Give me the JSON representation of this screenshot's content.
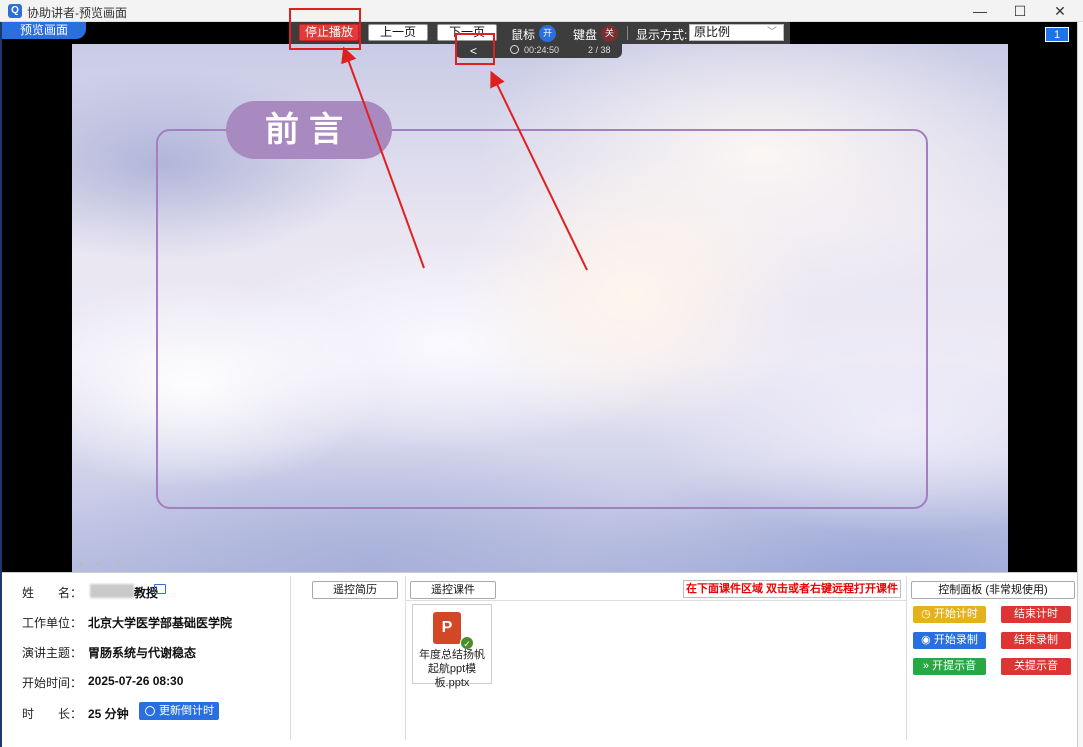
{
  "window": {
    "app_icon": "Q",
    "title": "协助讲者-预览画面",
    "minimize": "—",
    "maximize": "☐",
    "close": "✕"
  },
  "preview": {
    "tab_label": "预览画面",
    "page_badge": "1"
  },
  "slide": {
    "title": "前言"
  },
  "toolbar": {
    "stop_label": "停止播放",
    "prev_label": "上一页",
    "next_label": "下一页",
    "mouse_label": "鼠标",
    "mouse_state": "开",
    "keyboard_label": "键盘",
    "keyboard_state": "关",
    "display_label": "显示方式:",
    "display_value": "原比例",
    "prev_arrow": "<",
    "elapsed": "00:24:50",
    "page_count": "2 / 38"
  },
  "speaker": {
    "name_label": "姓　　名：",
    "name_suffix": "教授",
    "org_label": "工作单位：",
    "org_value": "北京大学医学部基础医学院",
    "topic_label": "演讲主题：",
    "topic_value": "胃肠系统与代谢稳态",
    "start_label": "开始时间：",
    "start_value": "2025-07-26 08:30",
    "duration_label": "时　　长：",
    "duration_value": "25 分钟",
    "countdown_button": "更新倒计时"
  },
  "remote": {
    "cv_button": "遥控简历",
    "courseware_button": "遥控课件",
    "notice": "在下面课件区域 双击或者右键远程打开课件",
    "file_name": "年度总结扬帆起航ppt模板.pptx",
    "file_icon": "P"
  },
  "control_panel": {
    "title": "控制面板 (非常规使用)",
    "start_timer": "开始计时",
    "end_timer": "结束计时",
    "start_record": "开始录制",
    "end_record": "结束录制",
    "open_sound": "开提示音",
    "close_sound": "关提示音"
  }
}
